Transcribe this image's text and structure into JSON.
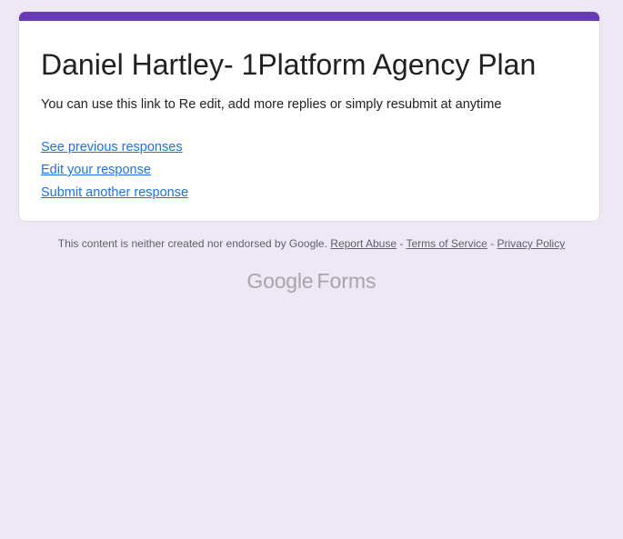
{
  "form": {
    "title": "Daniel Hartley- 1Platform Agency Plan",
    "confirmation_message": "You can use this link to Re edit, add more replies or simply resubmit at anytime",
    "links": {
      "see_previous": "See previous responses",
      "edit_response": "Edit your response",
      "submit_another": "Submit another response"
    }
  },
  "footer": {
    "disclaimer": "This content is neither created nor endorsed by Google.",
    "report_abuse": "Report Abuse",
    "separator": "-",
    "terms": "Terms of Service",
    "privacy": "Privacy Policy"
  },
  "brand": {
    "google": "Google",
    "forms": "Forms"
  },
  "colors": {
    "accent": "#673ab7",
    "background": "#ede7f6",
    "link": "#1a73e8"
  }
}
